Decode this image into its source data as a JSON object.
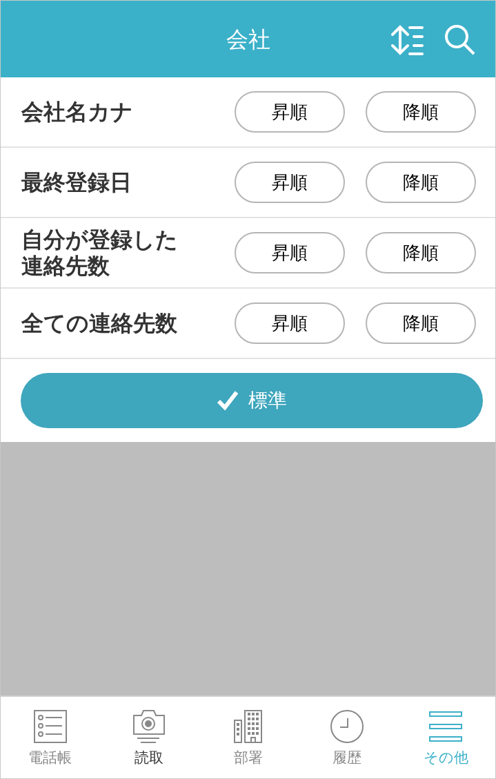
{
  "header": {
    "title": "会社"
  },
  "sort_rows": [
    {
      "label": "会社名カナ",
      "ascending": "昇順",
      "descending": "降順"
    },
    {
      "label": "最終登録日",
      "ascending": "昇順",
      "descending": "降順"
    },
    {
      "label": "自分が登録した連絡先数",
      "ascending": "昇順",
      "descending": "降順"
    },
    {
      "label": "全ての連絡先数",
      "ascending": "昇順",
      "descending": "降順"
    }
  ],
  "default_button": {
    "label": "標準"
  },
  "tab_bar": [
    {
      "label": "電話帳",
      "kind": "list",
      "selected": false,
      "emphasized": false
    },
    {
      "label": "読取",
      "kind": "camera",
      "selected": false,
      "emphasized": true
    },
    {
      "label": "部署",
      "kind": "building",
      "selected": false,
      "emphasized": false
    },
    {
      "label": "履歴",
      "kind": "clock",
      "selected": false,
      "emphasized": false
    },
    {
      "label": "その他",
      "kind": "menu",
      "selected": true,
      "emphasized": false
    }
  ]
}
